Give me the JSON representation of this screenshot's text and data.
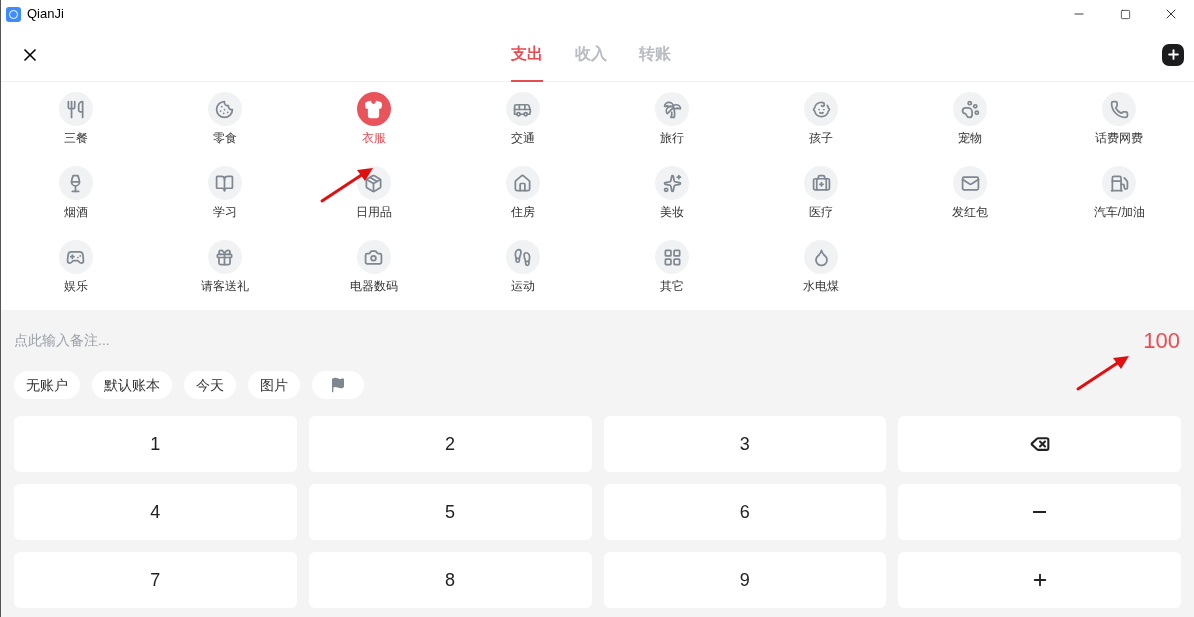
{
  "window": {
    "title": "QianJi"
  },
  "tabs": [
    {
      "label": "支出",
      "selected": true
    },
    {
      "label": "收入",
      "selected": false
    },
    {
      "label": "转账",
      "selected": false
    }
  ],
  "categories": [
    {
      "label": "三餐",
      "selected": false
    },
    {
      "label": "零食",
      "selected": false
    },
    {
      "label": "衣服",
      "selected": true
    },
    {
      "label": "交通",
      "selected": false
    },
    {
      "label": "旅行",
      "selected": false
    },
    {
      "label": "孩子",
      "selected": false
    },
    {
      "label": "宠物",
      "selected": false
    },
    {
      "label": "话费网费",
      "selected": false
    },
    {
      "label": "烟酒",
      "selected": false
    },
    {
      "label": "学习",
      "selected": false
    },
    {
      "label": "日用品",
      "selected": false
    },
    {
      "label": "住房",
      "selected": false
    },
    {
      "label": "美妆",
      "selected": false
    },
    {
      "label": "医疗",
      "selected": false
    },
    {
      "label": "发红包",
      "selected": false
    },
    {
      "label": "汽车/加油",
      "selected": false
    },
    {
      "label": "娱乐",
      "selected": false
    },
    {
      "label": "请客送礼",
      "selected": false
    },
    {
      "label": "电器数码",
      "selected": false
    },
    {
      "label": "运动",
      "selected": false
    },
    {
      "label": "其它",
      "selected": false
    },
    {
      "label": "水电煤",
      "selected": false
    }
  ],
  "note": {
    "placeholder": "点此输入备注..."
  },
  "amount": "100",
  "chips": [
    {
      "kind": "text",
      "label": "无账户"
    },
    {
      "kind": "text",
      "label": "默认账本"
    },
    {
      "kind": "text",
      "label": "今天"
    },
    {
      "kind": "text",
      "label": "图片"
    },
    {
      "kind": "flag"
    }
  ],
  "keypad": [
    {
      "kind": "digit",
      "label": "1"
    },
    {
      "kind": "digit",
      "label": "2"
    },
    {
      "kind": "digit",
      "label": "3"
    },
    {
      "kind": "backspace"
    },
    {
      "kind": "digit",
      "label": "4"
    },
    {
      "kind": "digit",
      "label": "5"
    },
    {
      "kind": "digit",
      "label": "6"
    },
    {
      "kind": "minus"
    },
    {
      "kind": "digit",
      "label": "7"
    },
    {
      "kind": "digit",
      "label": "8"
    },
    {
      "kind": "digit",
      "label": "9"
    },
    {
      "kind": "plus"
    }
  ]
}
